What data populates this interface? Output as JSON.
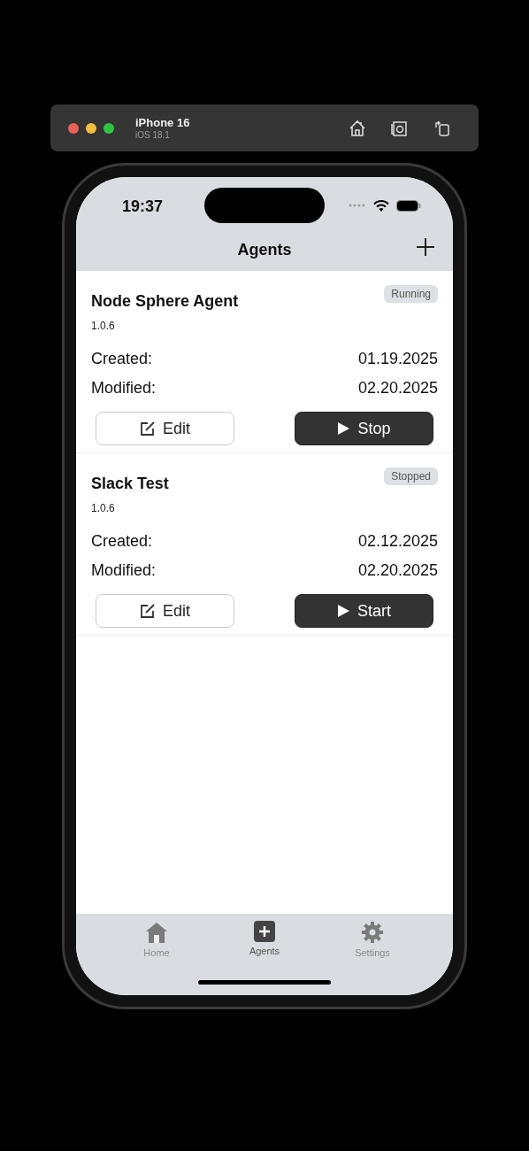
{
  "simulator": {
    "device": "iPhone 16",
    "os": "iOS 18.1"
  },
  "status_bar": {
    "time": "19:37"
  },
  "header": {
    "title": "Agents"
  },
  "agents": [
    {
      "name": "Node Sphere Agent",
      "version": "1.0.6",
      "status": "Running",
      "fields": [
        {
          "label": "Created:",
          "value": "01.19.2025"
        },
        {
          "label": "Modified:",
          "value": "02.20.2025"
        }
      ],
      "edit_label": "Edit",
      "action_label": "Stop"
    },
    {
      "name": "Slack Test",
      "version": "1.0.6",
      "status": "Stopped",
      "fields": [
        {
          "label": "Created:",
          "value": "02.12.2025"
        },
        {
          "label": "Modified:",
          "value": "02.20.2025"
        }
      ],
      "edit_label": "Edit",
      "action_label": "Start"
    }
  ],
  "tabs": [
    {
      "label": "Home",
      "kind": "home",
      "selected": false
    },
    {
      "label": "Agents",
      "kind": "agents",
      "selected": true
    },
    {
      "label": "Settings",
      "kind": "settings",
      "selected": false
    }
  ]
}
